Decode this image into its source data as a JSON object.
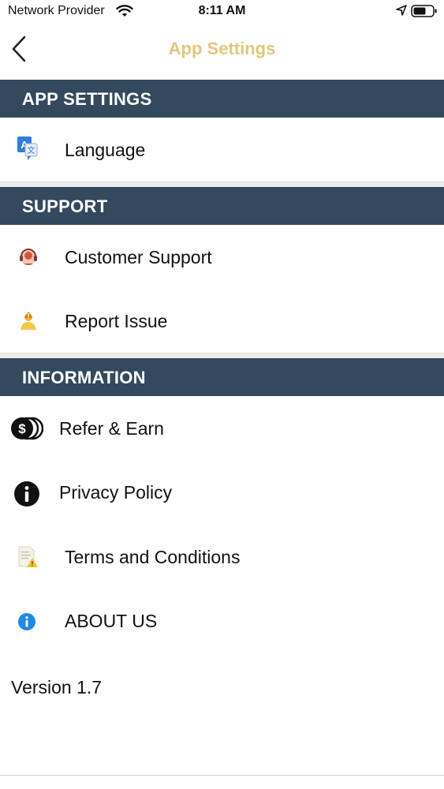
{
  "status_bar": {
    "carrier": "Network Provider",
    "time": "8:11 AM"
  },
  "navbar": {
    "title": "App Settings",
    "back_icon": "chevron-left-icon"
  },
  "sections": {
    "app_settings": {
      "header": "APP SETTINGS",
      "items": [
        {
          "label": "Language",
          "icon": "translate-icon"
        }
      ]
    },
    "support": {
      "header": "SUPPORT",
      "items": [
        {
          "label": "Customer Support",
          "icon": "customer-support-icon"
        },
        {
          "label": "Report Issue",
          "icon": "report-issue-icon"
        }
      ]
    },
    "information": {
      "header": "INFORMATION",
      "items": [
        {
          "label": "Refer & Earn",
          "icon": "coins-icon"
        },
        {
          "label": "Privacy Policy",
          "icon": "info-icon"
        },
        {
          "label": "Terms and Conditions",
          "icon": "document-warning-icon"
        },
        {
          "label": "ABOUT US",
          "icon": "about-info-icon"
        }
      ]
    }
  },
  "version": "Version 1.7",
  "colors": {
    "header_bg": "#34495E",
    "title_gold": "#E3C67C",
    "about_blue": "#1E88E5"
  }
}
